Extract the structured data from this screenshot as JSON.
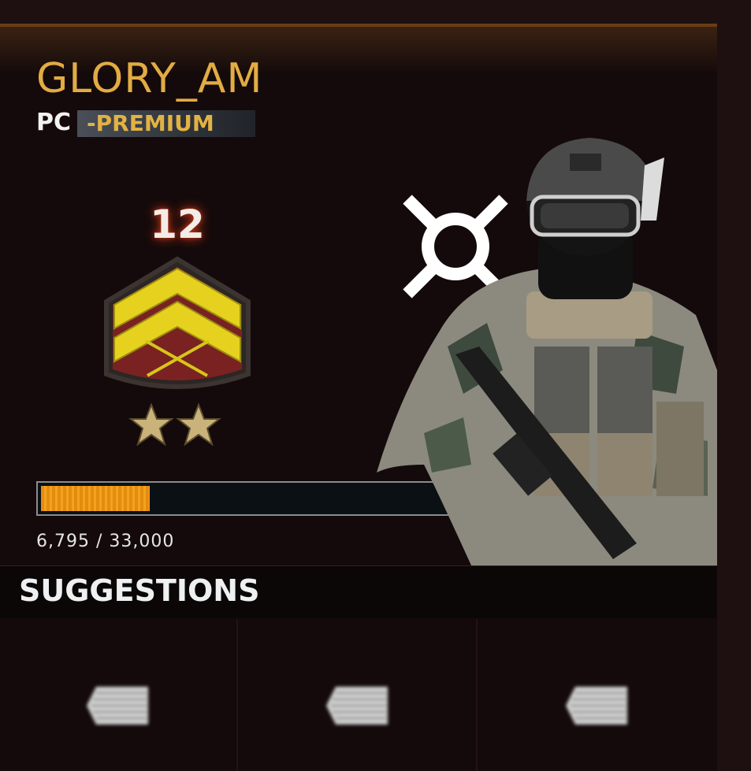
{
  "profile": {
    "name": "GLORY_AM",
    "platform": "PC",
    "membership": "-PREMIUM",
    "rank": "12",
    "rank_stars": 2,
    "progress_fraction": 0.206,
    "xp_text": "6,795 / 33,000"
  },
  "suggestions": {
    "title": "SUGGESTIONS",
    "tiles": [
      {
        "icon": "placeholder-icon"
      },
      {
        "icon": "placeholder-icon"
      },
      {
        "icon": "placeholder-icon"
      }
    ]
  },
  "colors": {
    "name_gold": "#e2ac43",
    "progress_orange": "#f3a21e",
    "rank_glow": "#d03a1a",
    "background": "#140a0b"
  }
}
